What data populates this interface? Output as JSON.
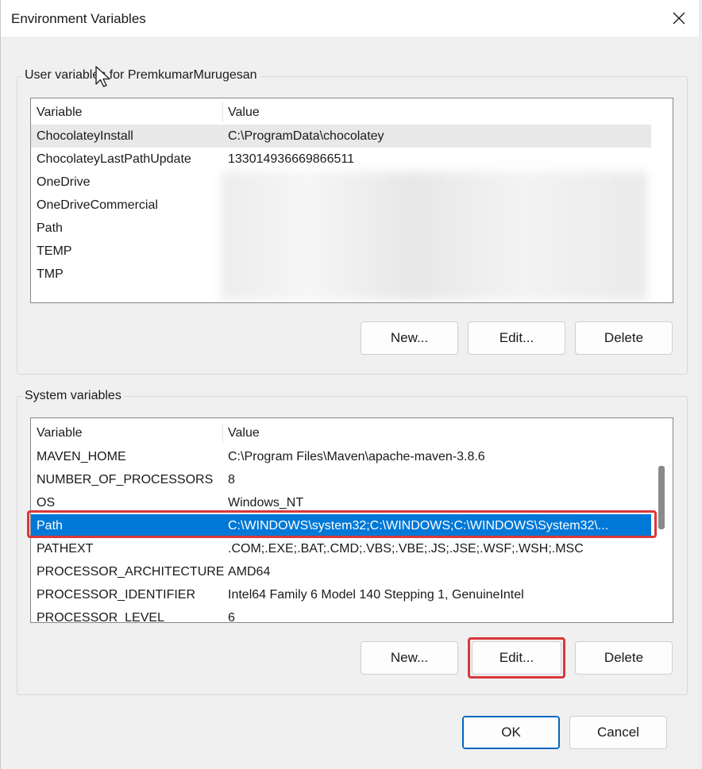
{
  "window": {
    "title": "Environment Variables",
    "close_icon": "close-icon"
  },
  "user_vars": {
    "group_label": "User variables for PremkumarMurugesan",
    "headers": {
      "variable": "Variable",
      "value": "Value"
    },
    "rows": [
      {
        "variable": "ChocolateyInstall",
        "value": "C:\\ProgramData\\chocolatey"
      },
      {
        "variable": "ChocolateyLastPathUpdate",
        "value": "133014936669866511"
      },
      {
        "variable": "OneDrive",
        "value": ""
      },
      {
        "variable": "OneDriveCommercial",
        "value": ""
      },
      {
        "variable": "Path",
        "value": ""
      },
      {
        "variable": "TEMP",
        "value": ""
      },
      {
        "variable": "TMP",
        "value": ""
      }
    ],
    "buttons": {
      "new": "New...",
      "edit": "Edit...",
      "delete": "Delete"
    }
  },
  "system_vars": {
    "group_label": "System variables",
    "headers": {
      "variable": "Variable",
      "value": "Value"
    },
    "rows": [
      {
        "variable": "MAVEN_HOME",
        "value": "C:\\Program Files\\Maven\\apache-maven-3.8.6"
      },
      {
        "variable": "NUMBER_OF_PROCESSORS",
        "value": "8"
      },
      {
        "variable": "OS",
        "value": "Windows_NT"
      },
      {
        "variable": "Path",
        "value": "C:\\WINDOWS\\system32;C:\\WINDOWS;C:\\WINDOWS\\System32\\..."
      },
      {
        "variable": "PATHEXT",
        "value": ".COM;.EXE;.BAT;.CMD;.VBS;.VBE;.JS;.JSE;.WSF;.WSH;.MSC"
      },
      {
        "variable": "PROCESSOR_ARCHITECTURE",
        "value": "AMD64"
      },
      {
        "variable": "PROCESSOR_IDENTIFIER",
        "value": "Intel64 Family 6 Model 140 Stepping 1, GenuineIntel"
      },
      {
        "variable": "PROCESSOR_LEVEL",
        "value": "6"
      }
    ],
    "selected_row": "Path",
    "buttons": {
      "new": "New...",
      "edit": "Edit...",
      "delete": "Delete"
    }
  },
  "dialog_buttons": {
    "ok": "OK",
    "cancel": "Cancel"
  },
  "colors": {
    "selection": "#0078d7",
    "highlight_annotation": "#d9383a",
    "primary_border": "#0067c0"
  }
}
